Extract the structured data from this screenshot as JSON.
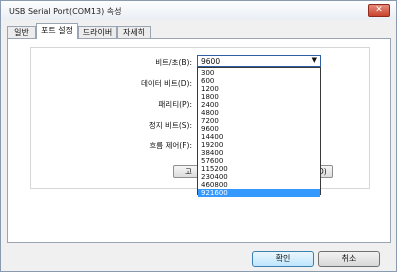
{
  "window": {
    "title": "USB Serial Port(COM13) 속성",
    "close_glyph": "✕"
  },
  "tabs": [
    {
      "label": "일반"
    },
    {
      "label": "포트 설정"
    },
    {
      "label": "드라이버"
    },
    {
      "label": "자세히"
    }
  ],
  "settings": {
    "bits_per_second_label": "비트/초(B):",
    "data_bits_label": "데이터 비트(D):",
    "parity_label": "패리티(P):",
    "stop_bits_label": "정지 비트(S):",
    "flow_control_label": "흐름 제어(F):",
    "bits_per_second_value": "9600",
    "dropdown_arrow": "▼"
  },
  "baud_options": [
    "300",
    "600",
    "1200",
    "1800",
    "2400",
    "4800",
    "7200",
    "9600",
    "14400",
    "19200",
    "38400",
    "57600",
    "115200",
    "230400",
    "460800",
    "921600"
  ],
  "selected_option_index": 15,
  "partial_buttons": {
    "left_text": "고",
    "right_text": "D)"
  },
  "footer": {
    "ok_label": "확인",
    "cancel_label": "취소"
  },
  "colors": {
    "selection": "#3399ff",
    "close_button": "#c8432c"
  }
}
